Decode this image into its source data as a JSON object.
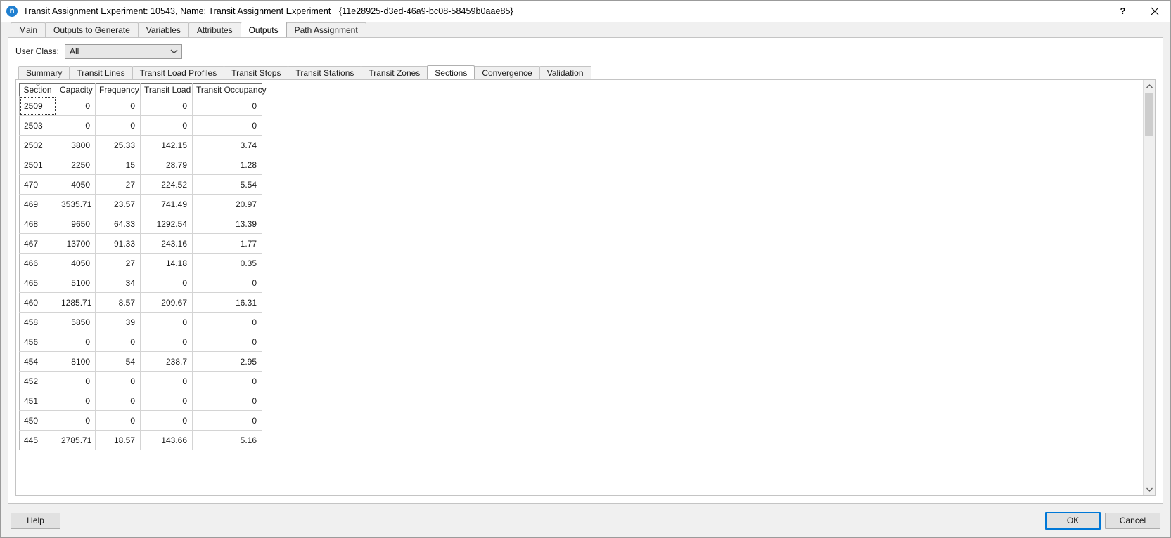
{
  "window": {
    "icon_label": "n",
    "title": "Transit Assignment Experiment: 10543, Name: Transit Assignment Experiment",
    "guid": "{11e28925-d3ed-46a9-bc08-58459b0aae85}",
    "help_icon": "?",
    "close_icon": "close-icon"
  },
  "outer_tabs": [
    {
      "label": "Main",
      "selected": false
    },
    {
      "label": "Outputs to Generate",
      "selected": false
    },
    {
      "label": "Variables",
      "selected": false
    },
    {
      "label": "Attributes",
      "selected": false
    },
    {
      "label": "Outputs",
      "selected": true
    },
    {
      "label": "Path Assignment",
      "selected": false
    }
  ],
  "user_class": {
    "label": "User Class:",
    "value": "All",
    "options": [
      "All"
    ]
  },
  "inner_tabs": [
    {
      "label": "Summary",
      "selected": false
    },
    {
      "label": "Transit Lines",
      "selected": false
    },
    {
      "label": "Transit Load Profiles",
      "selected": false
    },
    {
      "label": "Transit Stops",
      "selected": false
    },
    {
      "label": "Transit Stations",
      "selected": false
    },
    {
      "label": "Transit Zones",
      "selected": false
    },
    {
      "label": "Sections",
      "selected": true
    },
    {
      "label": "Convergence",
      "selected": false
    },
    {
      "label": "Validation",
      "selected": false
    }
  ],
  "table": {
    "sort_column": "Section",
    "sort_direction": "descending",
    "columns": [
      "Section",
      "Capacity",
      "Frequency",
      "Transit Load",
      "Transit Occupancy"
    ],
    "rows": [
      [
        "2509",
        "0",
        "0",
        "0",
        "0"
      ],
      [
        "2503",
        "0",
        "0",
        "0",
        "0"
      ],
      [
        "2502",
        "3800",
        "25.33",
        "142.15",
        "3.74"
      ],
      [
        "2501",
        "2250",
        "15",
        "28.79",
        "1.28"
      ],
      [
        "470",
        "4050",
        "27",
        "224.52",
        "5.54"
      ],
      [
        "469",
        "3535.71",
        "23.57",
        "741.49",
        "20.97"
      ],
      [
        "468",
        "9650",
        "64.33",
        "1292.54",
        "13.39"
      ],
      [
        "467",
        "13700",
        "91.33",
        "243.16",
        "1.77"
      ],
      [
        "466",
        "4050",
        "27",
        "14.18",
        "0.35"
      ],
      [
        "465",
        "5100",
        "34",
        "0",
        "0"
      ],
      [
        "460",
        "1285.71",
        "8.57",
        "209.67",
        "16.31"
      ],
      [
        "458",
        "5850",
        "39",
        "0",
        "0"
      ],
      [
        "456",
        "0",
        "0",
        "0",
        "0"
      ],
      [
        "454",
        "8100",
        "54",
        "238.7",
        "2.95"
      ],
      [
        "452",
        "0",
        "0",
        "0",
        "0"
      ],
      [
        "451",
        "0",
        "0",
        "0",
        "0"
      ],
      [
        "450",
        "0",
        "0",
        "0",
        "0"
      ],
      [
        "445",
        "2785.71",
        "18.57",
        "143.66",
        "5.16"
      ]
    ]
  },
  "scrollbar": {
    "up_arrow": "chevron-up-icon",
    "down_arrow": "chevron-down-icon"
  },
  "footer": {
    "help": "Help",
    "ok": "OK",
    "cancel": "Cancel"
  },
  "colors": {
    "accent": "#0078d7",
    "window_bg": "#f0f0f0",
    "panel_bg": "#ffffff",
    "icon_blue": "#1f7fd0"
  }
}
